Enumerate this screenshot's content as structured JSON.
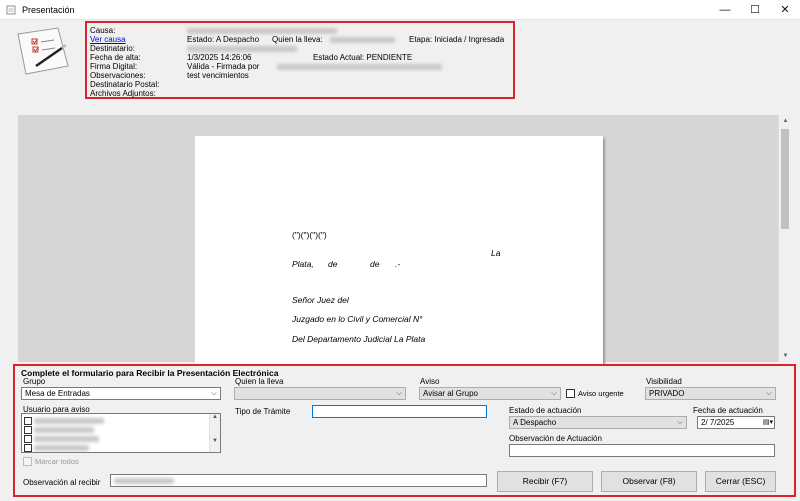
{
  "window": {
    "title": "Presentación",
    "min": "—",
    "max": "☐",
    "close": "✕"
  },
  "header": {
    "causa_label": "Causa:",
    "ver_causa": "Ver causa",
    "estado": "Estado: A Despacho",
    "quien_lleva_label": "Quien la lleva:",
    "etapa": "Etapa: Iniciada / Ingresada",
    "destinatario_label": "Destinatario:",
    "fecha_alta_label": "Fecha de alta:",
    "fecha_alta_value": "1/3/2025 14:26:06",
    "estado_actual": "Estado Actual:    PENDIENTE",
    "firma_label": "Firma Digital:",
    "firma_value": "Válida - Firmada por",
    "observaciones_label": "Observaciones:",
    "observaciones_value": "test vencimientos",
    "dest_postal_label": "Destinatario Postal:",
    "adjuntos_label": "Archivos Adjuntos:"
  },
  "document": {
    "line1": "(\")(\")(\")(\")",
    "line2a": "La",
    "line2b_1": "Plata,",
    "line2b_2": "de",
    "line2b_3": "de",
    "line2b_4": ".-",
    "line3": "Señor Juez del",
    "line4": "Juzgado en lo Civil y Comercial N°",
    "line5": "Del Departamento Judicial La Plata"
  },
  "form": {
    "title": "Complete el formulario para Recibir la Presentación Electrónica",
    "grupo_label": "Grupo",
    "grupo_value": "Mesa de Entradas",
    "quien_lleva_label": "Quien la lleva",
    "quien_lleva_value": "",
    "aviso_label": "Aviso",
    "aviso_value": "Avisar al Grupo",
    "aviso_urgente": "Aviso urgente",
    "visibilidad_label": "Visibilidad",
    "visibilidad_value": "PRIVADO",
    "usuario_aviso_label": "Usuario para aviso",
    "marcar_todos": "Marcar todos",
    "tipo_tramite_label": "Tipo de Trámite",
    "tipo_tramite_value": "",
    "estado_actuacion_label": "Estado de actuación",
    "estado_actuacion_value": "A Despacho",
    "fecha_actuacion_label": "Fecha de actuación",
    "fecha_actuacion_value": "2/ 7/2025",
    "obs_actuacion_label": "Observación de Actuación",
    "obs_actuacion_value": "",
    "obs_recibir_label": "Observación al recibir",
    "btn_recibir": "Recibir (F7)",
    "btn_observar": "Observar (F8)",
    "btn_cerrar": "Cerrar (ESC)"
  }
}
